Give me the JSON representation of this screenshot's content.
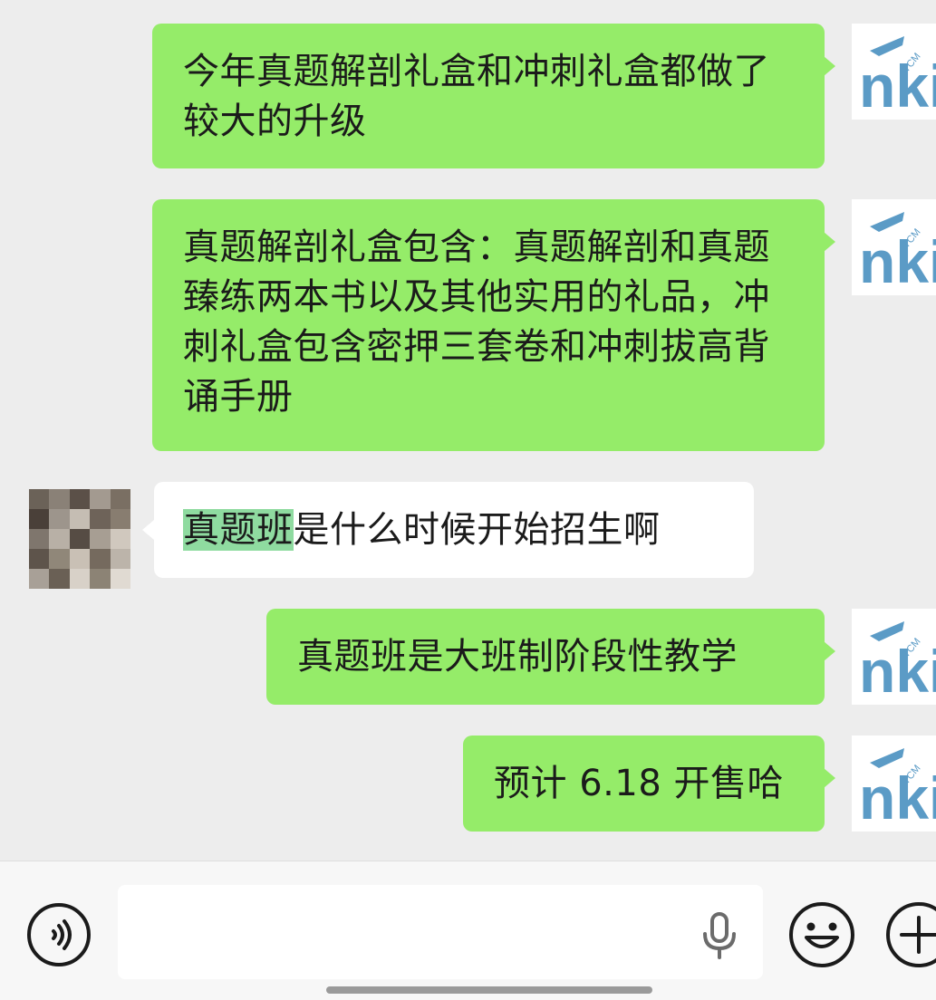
{
  "messages": [
    {
      "direction": "outgoing",
      "text": "今年真题解剖礼盒和冲刺礼盒都做了较大的升级",
      "avatar_icon": "mnki-logo-icon"
    },
    {
      "direction": "outgoing",
      "text": "真题解剖礼盒包含：真题解剖和真题臻练两本书以及其他实用的礼品，冲刺礼盒包含密押三套卷和冲刺拔高背诵手册",
      "avatar_icon": "mnki-logo-icon"
    },
    {
      "direction": "incoming",
      "highlighted": "真题班",
      "text": "是什么时候开始招生啊",
      "avatar_icon": "pixelated-avatar"
    },
    {
      "direction": "outgoing",
      "text": "真题班是大班制阶段性教学",
      "avatar_icon": "mnki-logo-icon"
    },
    {
      "direction": "outgoing",
      "text": "预计 6.18 开售哈",
      "avatar_icon": "mnki-logo-icon"
    }
  ],
  "logo": {
    "text": "nki",
    "small_text": "TCM",
    "color": "#5b9bc6"
  },
  "input_bar": {
    "input_value": "",
    "icons": [
      "voice-icon",
      "microphone-icon",
      "emoji-icon",
      "plus-icon"
    ]
  },
  "colors": {
    "outgoing_bubble": "#95ec69",
    "incoming_bubble": "#ffffff",
    "background": "#ededed",
    "highlight": "#8fdba0"
  }
}
